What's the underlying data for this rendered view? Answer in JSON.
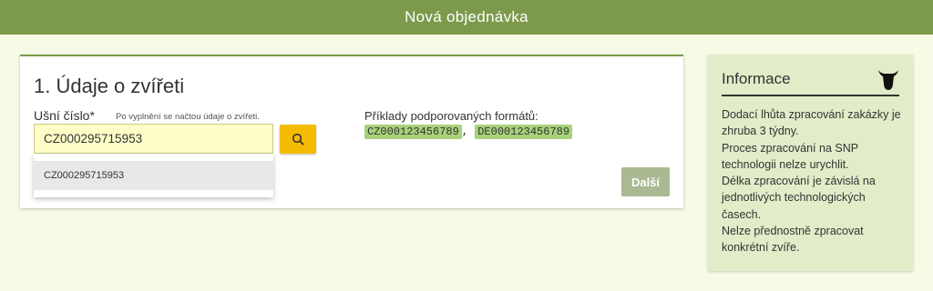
{
  "header": {
    "title": "Nová objednávka"
  },
  "section": {
    "title": "1. Údaje o zvířeti",
    "ear_label": "Ušní číslo*",
    "ear_hint": "Po vyplnění se načtou údaje o zvířeti.",
    "ear_value": "CZ000295715953",
    "suggestion": "CZ000295715953",
    "examples_label": "Příklady podporovaných formátů:",
    "examples": [
      "CZ000123456789",
      "DE000123456789"
    ],
    "examples_separator": ",",
    "next_label": "Další",
    "search_icon": "search-icon"
  },
  "info": {
    "title": "Informace",
    "icon": "cow-head-icon",
    "lines": [
      "Dodací lhůta zpracování zakázky je zhruba 3 týdny.",
      "Proces zpracování na SNP technologii nelze urychlit.",
      "Délka zpracování je závislá na jednotlivých technologických časech.",
      "Nelze přednostně zpracovat konkrétní zvíře."
    ]
  },
  "colors": {
    "header_bg": "#7d9a4c",
    "page_bg": "#f7fbe6",
    "search_button": "#f5bb00",
    "tag_bg": "#a8d27a",
    "next_button": "#a9b991",
    "info_bg": "#e2ecc8"
  }
}
